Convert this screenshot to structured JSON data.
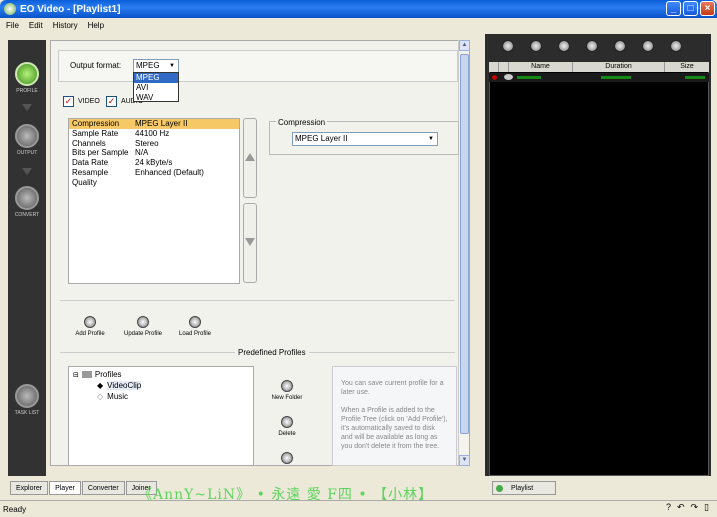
{
  "window": {
    "title": "EO Video - [Playlist1]"
  },
  "menu": [
    "File",
    "Edit",
    "History",
    "Help"
  ],
  "sidebar": [
    {
      "label": "PROFILE"
    },
    {
      "label": "OUTPUT"
    },
    {
      "label": "CONVERT"
    },
    {
      "label": "TASK LIST"
    }
  ],
  "output": {
    "label": "Output format:",
    "value": "MPEG",
    "options": [
      "MPEG",
      "AVI",
      "WAV"
    ],
    "video_label": "VIDEO",
    "audio_label": "AUDIO"
  },
  "properties": [
    {
      "key": "Compression",
      "value": "MPEG Layer II"
    },
    {
      "key": "Sample Rate",
      "value": "44100 Hz"
    },
    {
      "key": "Channels",
      "value": "Stereo"
    },
    {
      "key": "Bits per Sample",
      "value": "N/A"
    },
    {
      "key": "Data Rate",
      "value": "24 kByte/s"
    },
    {
      "key": "Resample Quality",
      "value": "Enhanced (Default)"
    }
  ],
  "compression": {
    "label": "Compression",
    "value": "MPEG Layer II"
  },
  "profile_buttons": {
    "add": "Add Profile",
    "update": "Update Profile",
    "load": "Load Profile"
  },
  "predefined": {
    "title": "Predefined Profiles",
    "root": "Profiles",
    "items": [
      "VideoClip",
      "Music"
    ],
    "new_folder": "New Folder",
    "delete": "Delete",
    "info": "You can save current profile for a later use.\n\nWhen a Profile is added to the Profile Tree (click on 'Add Profile'), it's automatically saved to disk and will be available as long as you don't delete it from the tree."
  },
  "tabs": [
    "Explorer",
    "Player",
    "Converter",
    "Joiner"
  ],
  "overlay_text": "《AnnY~LiN》 • 永遠 愛 F四 • 【小林】",
  "playlist": {
    "columns": [
      "Name",
      "Duration",
      "Size"
    ],
    "tab": "Playlist"
  },
  "status": {
    "text": "Ready",
    "help": "?"
  }
}
